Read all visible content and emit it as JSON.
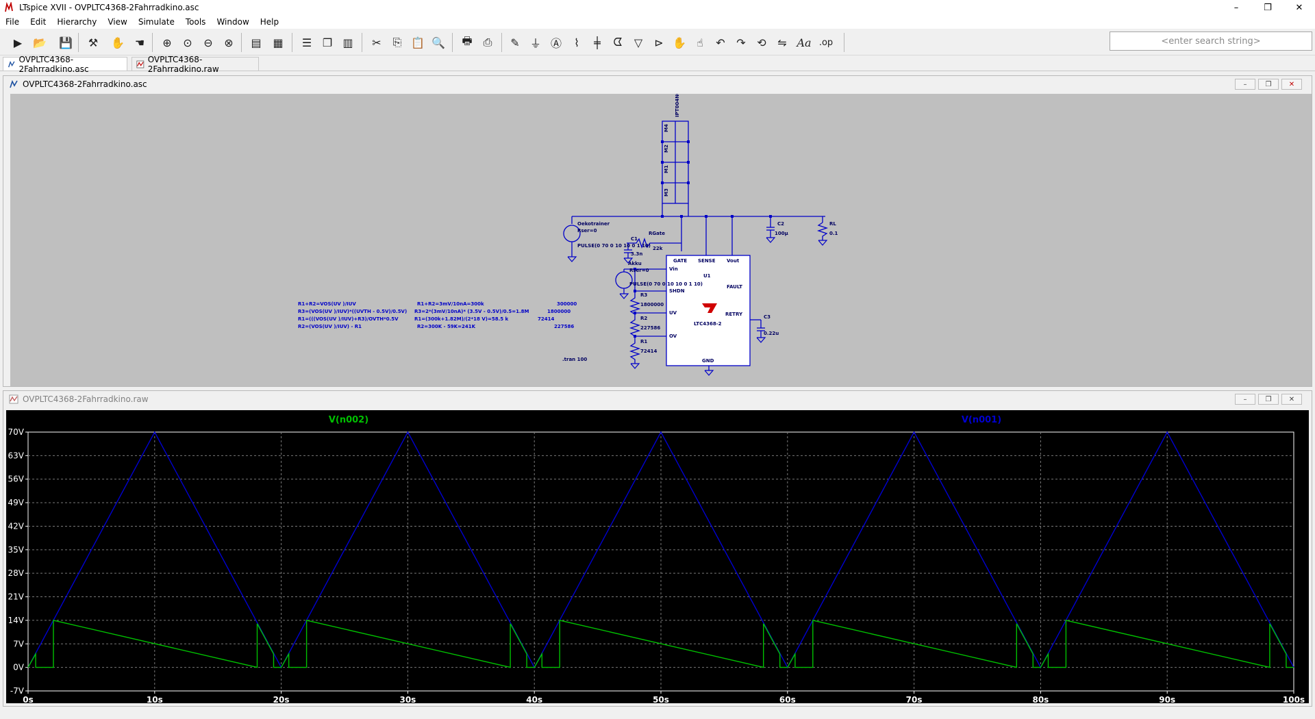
{
  "window": {
    "title": "LTspice XVII - OVPLTC4368-2Fahrradkino.asc",
    "minimize": "–",
    "maximize": "❐",
    "close": "✕"
  },
  "menu": [
    "File",
    "Edit",
    "Hierarchy",
    "View",
    "Simulate",
    "Tools",
    "Window",
    "Help"
  ],
  "toolbar": {
    "icons": [
      "run-icon",
      "open-icon",
      "save-icon",
      "control-panel-icon",
      "halt-icon",
      "pan-icon",
      "zoom-in-icon",
      "zoom-full-icon",
      "zoom-out-icon",
      "zoom-cancel-icon",
      "plot-icon",
      "autorange-icon",
      "tile-horizontal-icon",
      "cascade-icon",
      "tile-vertical-icon",
      "cut-icon",
      "copy-icon",
      "paste-icon",
      "find-icon",
      "print-icon",
      "print-preview-icon",
      "draw-wire-icon",
      "ground-icon",
      "label-net-icon",
      "resistor-icon",
      "capacitor-icon",
      "inductor-icon",
      "diode-icon",
      "component-icon",
      "move-icon",
      "drag-icon",
      "undo-icon",
      "redo-icon",
      "rotate-icon",
      "mirror-icon",
      "text-icon",
      "spice-directive-icon"
    ],
    "search_placeholder": "<enter search string>"
  },
  "tabs": [
    {
      "label": "OVPLTC4368-2Fahrradkino.asc",
      "active": true
    },
    {
      "label": "OVPLTC4368-2Fahrradkino.raw",
      "active": false
    }
  ],
  "schematic_window": {
    "title": "OVPLTC4368-2Fahrradkino.asc",
    "labels": {
      "mosfet_model": "IPT004N03L",
      "m4": "M4",
      "m2": "M2",
      "m1": "M1",
      "m3": "M3",
      "source1": "Oekotrainer",
      "source1_rser": "Rser=0",
      "source1_pulse": "PULSE(0 70 0 10 10 0 1 10)",
      "rgate": "RGate",
      "rgate_val": "22k",
      "c1": "C1",
      "c1_val": "3.3n",
      "c2": "C2",
      "c2_val": "100µ",
      "rl": "RL",
      "rl_val": "0.1",
      "akku": "Akku",
      "akku_rser": "Rser=0",
      "akku_pulse": "PULSE(0 70 0 10 10 0 1 10)",
      "r3": "R3",
      "r3_val": "1800000",
      "r2": "R2",
      "r2_val": "227586",
      "r1": "R1",
      "r1_val": "72414",
      "c3": "C3",
      "c3_val": "0.22u",
      "u1": "U1",
      "ic_name": "LTC4368-2",
      "pin_gate": "GATE",
      "pin_sense": "SENSE",
      "pin_vout": "Vout",
      "pin_vin": "Vin",
      "pin_shdn": "SHDN",
      "pin_uv": "UV",
      "pin_ov": "OV",
      "pin_fault": "FAULT",
      "pin_retry": "RETRY",
      "pin_gnd": "GND",
      "tran": ".tran 100"
    },
    "comments": [
      [
        "R1+R2=VOS(UV )/IUV",
        "R1+R2=3mV/10nA=300k",
        "300000"
      ],
      [
        "R3=(VOS(UV )/IUV)*((UVTH - 0.5V)/0.5V)",
        "R3=2*(3mV/10nA)* (3.5V - 0.5V)/0.5=1.8M",
        "1800000"
      ],
      [
        "R1=(((VOS(UV )/IUV)+R3)/OVTH*0.5V",
        "R1=(300k+1.82M)/(2*18 V)=58.5 k",
        "72414"
      ],
      [
        "R2=(VOS(UV )/IUV) - R1",
        "R2=300K - 59K=241K",
        "227586"
      ]
    ]
  },
  "waveform_window": {
    "title": "OVPLTC4368-2Fahrradkino.raw",
    "legend": [
      {
        "name": "V(n002)",
        "color": "#00c000"
      },
      {
        "name": "V(n001)",
        "color": "#0000d0"
      }
    ]
  },
  "chart_data": {
    "type": "line",
    "xlabel": "",
    "ylabel": "",
    "xlim": [
      0,
      100
    ],
    "ylim": [
      -7,
      70
    ],
    "x_ticks": [
      "0s",
      "10s",
      "20s",
      "30s",
      "40s",
      "50s",
      "60s",
      "70s",
      "80s",
      "90s",
      "100s"
    ],
    "y_ticks": [
      "70V",
      "63V",
      "56V",
      "49V",
      "42V",
      "35V",
      "28V",
      "21V",
      "14V",
      "7V",
      "0V",
      "-7V"
    ],
    "grid": true,
    "colors": {
      "n001": "#0000d0",
      "n002": "#00c000",
      "background": "#000000",
      "grid": "#7a7a7a"
    },
    "series": [
      {
        "name": "V(n001)",
        "x": [
          0,
          10,
          20,
          30,
          40,
          50,
          60,
          70,
          80,
          90,
          100
        ],
        "y": [
          0,
          70,
          0,
          70,
          0,
          70,
          0,
          70,
          0,
          70,
          0
        ]
      },
      {
        "name": "V(n002)",
        "x": [
          0,
          0.6,
          0.6,
          2,
          2,
          18.1,
          18.1,
          19.4,
          19.4,
          20,
          20.6,
          20.6,
          22,
          22,
          38.1,
          38.1,
          39.4,
          39.4,
          40,
          40.6,
          40.6,
          42,
          42,
          58.1,
          58.1,
          59.4,
          59.4,
          60,
          60.6,
          60.6,
          62,
          62,
          78.1,
          78.1,
          79.4,
          79.4,
          80,
          80.6,
          80.6,
          82,
          82,
          98.1,
          98.1,
          99.4,
          99.4,
          100
        ],
        "y": [
          0,
          4,
          0,
          0,
          14,
          0,
          13,
          4,
          0,
          0,
          4,
          0,
          0,
          14,
          0,
          13,
          4,
          0,
          0,
          4,
          0,
          0,
          14,
          0,
          13,
          4,
          0,
          0,
          4,
          0,
          0,
          14,
          0,
          13,
          4,
          0,
          0,
          4,
          0,
          0,
          14,
          0,
          13,
          4,
          0,
          0
        ]
      }
    ]
  }
}
